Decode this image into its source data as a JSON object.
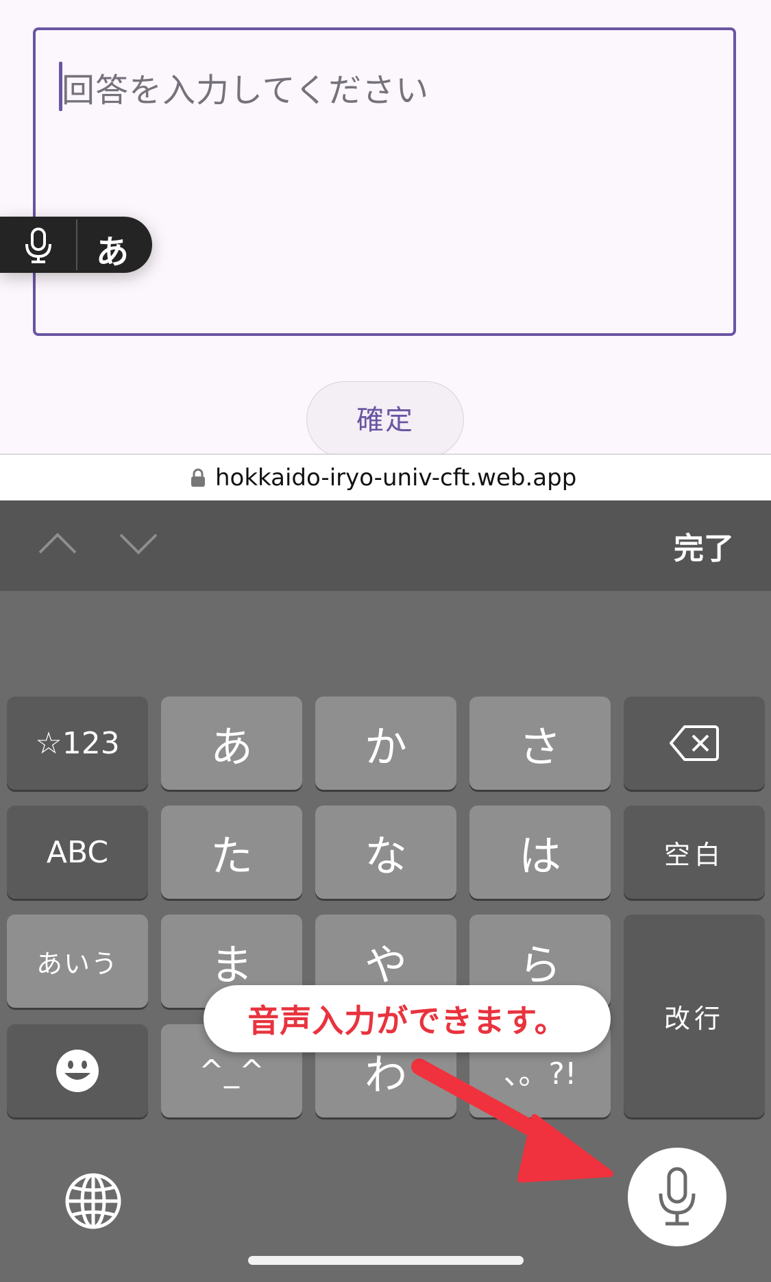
{
  "form": {
    "answer_placeholder": "回答を入力してください",
    "confirm_label": "確定"
  },
  "voice_toggle": {
    "kana_label": "あ"
  },
  "browser": {
    "url": "hokkaido-iryo-univ-cft.web.app"
  },
  "accessory_bar": {
    "done_label": "完了"
  },
  "keyboard": {
    "row1": [
      "☆123",
      "あ",
      "か",
      "さ"
    ],
    "row2": [
      "ABC",
      "た",
      "な",
      "は",
      "空白"
    ],
    "row3": [
      "あいう",
      "ま",
      "や",
      "ら"
    ],
    "row4": [
      "^_^",
      "わ",
      "、。?!"
    ],
    "return_label": "改行"
  },
  "callout": {
    "text": "音声入力ができます。"
  },
  "colors": {
    "accent": "#6a55a2",
    "callout_text": "#e8333e",
    "arrow": "#f0323e"
  },
  "icons": [
    "microphone-icon",
    "lock-icon",
    "chevron-up-icon",
    "chevron-down-icon",
    "backspace-icon",
    "emoji-icon",
    "globe-icon"
  ]
}
